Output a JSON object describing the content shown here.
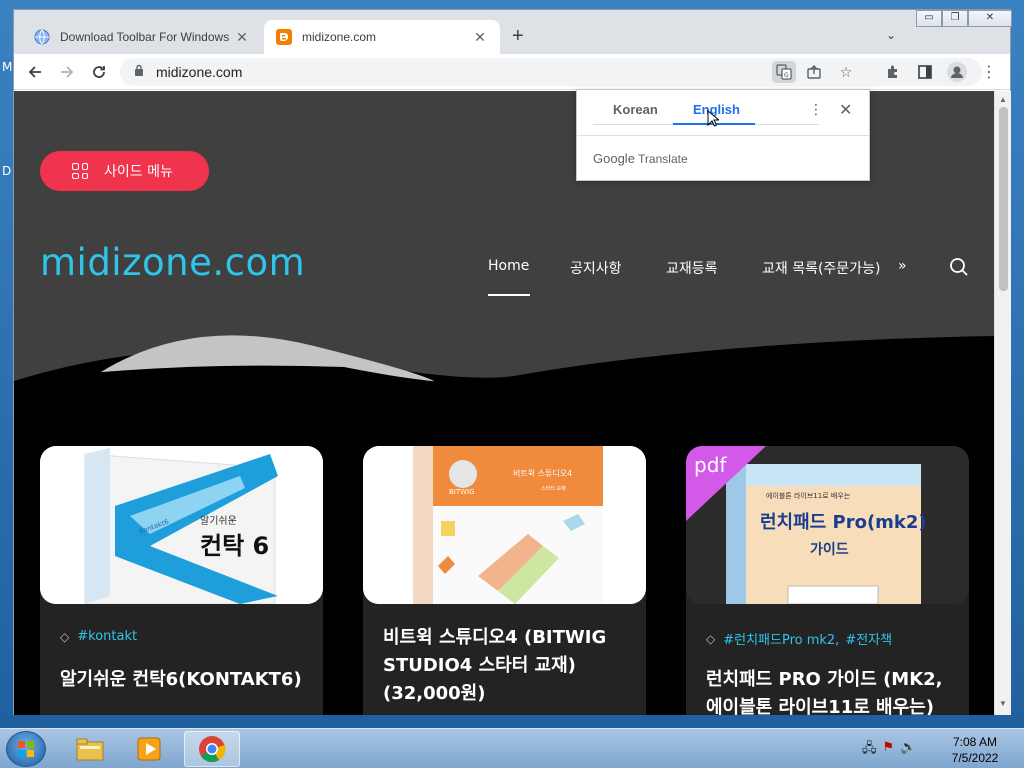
{
  "desktop": {
    "left_glyphs": [
      "M",
      "D"
    ]
  },
  "browser": {
    "tabs": [
      {
        "title": "Download Toolbar For Windows",
        "favicon": "globe-icon"
      },
      {
        "title": "midizone.com",
        "favicon": "blogger-icon"
      }
    ],
    "url": "midizone.com",
    "window_controls": [
      "minimize",
      "restore",
      "close"
    ]
  },
  "site": {
    "menu_button": "사이드 메뉴",
    "logo": "midizone.com",
    "nav": [
      {
        "label": "Home",
        "active": true
      },
      {
        "label": "공지사항"
      },
      {
        "label": "교재등록"
      },
      {
        "label": "교재 목록(주문가능)"
      }
    ],
    "nav_more": "»"
  },
  "cards": [
    {
      "tags": [
        "#kontakt"
      ],
      "title": "알기쉬운 컨탁6(KONTAKT6)",
      "cover": {
        "text_small": "알기쉬운",
        "text_big": "컨탁 6",
        "brand": "Kontakt6"
      }
    },
    {
      "tags": [],
      "title": "비트윅 스튜디오4 (BITWIG STUDIO4 스타터 교재) (32,000원)",
      "cover": {
        "text_small": "비트윅 스튜디오4",
        "sub": "스타터 교재",
        "brand": "BITWIG"
      }
    },
    {
      "tags": [
        "#런치패드Pro mk2,",
        "#전자책"
      ],
      "title": "런치패드 PRO 가이드 (MK2, 에이블톤 라이브11로 배우는)",
      "cover": {
        "badge": "pdf",
        "text_small": "에이블톤 라이브11로 배우는",
        "text_big": "런치패드 Pro(mk2)",
        "sub": "가이드"
      }
    }
  ],
  "translate_popup": {
    "source_lang": "Korean",
    "target_lang": "English",
    "footer_google": "Google",
    "footer_translate": "Translate"
  },
  "taskbar": {
    "time": "7:08 AM",
    "date": "7/5/2022",
    "apps": [
      "explorer",
      "media-player",
      "chrome"
    ]
  },
  "colors": {
    "accent_cyan": "#2ec5e8",
    "menu_red": "#f0344d",
    "header_gray": "#404040",
    "chrome_blue": "#1a73e8"
  }
}
